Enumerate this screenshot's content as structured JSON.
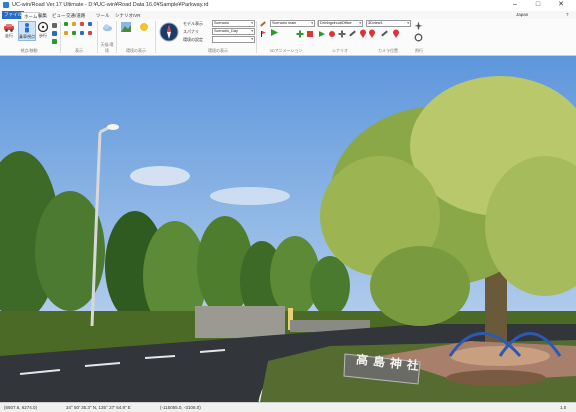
{
  "window": {
    "title": "UC-win/Road Ver.17 Ultimate - D:¥UC-win¥Road Data 16.0¥Sample¥Parkway.rd",
    "minimize": "–",
    "maximize": "□",
    "close": "✕"
  },
  "menu": {
    "tabs": [
      "ファイル",
      "ホーム",
      "編集",
      "ビュー",
      "交通/道路",
      "ツール",
      "シナリオ/VR"
    ],
    "right_items": [
      "Japan",
      "?"
    ]
  },
  "ribbon": {
    "buttons": {
      "vehicle": "走行",
      "ride": "乗車視点",
      "walk": "歩行",
      "driving_sim": "ビー"
    },
    "group_labels": {
      "movement": "視点/移動",
      "display": "表示",
      "weather": "天候/環境",
      "setting": "環境の表示",
      "animation": "3Dアニメーション",
      "scenario": "シナリオ",
      "camera": "カメラ位置",
      "flight": "飛行"
    },
    "fields": {
      "model_label": "モデル表示",
      "model_value": "Scenario",
      "time_label": "スパナリ",
      "time_value": "Scenario_Day",
      "env_label": "環境の設定",
      "env_value": "",
      "route_value": "Scenario main",
      "route2_value": "DrivingcircuitOffice",
      "view_value": "3Dview1"
    },
    "icons": [
      "car-icon",
      "person-icon",
      "steering-wheel-icon",
      "flag-icon",
      "terrain-icon",
      "compass-icon",
      "play-icon",
      "stop-icon",
      "record-icon",
      "camera-icon",
      "plus-icon",
      "flag-pin-icon"
    ]
  },
  "status": {
    "coords": "(6507.6, 6274.0)",
    "latlon": "34° 50' 35.3\" N, 135° 27' 54.9\" E",
    "extra": "(-115055.0, -3106.0)",
    "zoom": "1.0"
  },
  "scene": {
    "sign_text": "高島神社",
    "colors": {
      "sky_top": "#5d96dc",
      "sky_bottom": "#d6e6f5",
      "road": "#323539",
      "grass": "#4a6a25",
      "tree_light": "#b8c86a",
      "tree_dark": "#3e6a28"
    }
  }
}
